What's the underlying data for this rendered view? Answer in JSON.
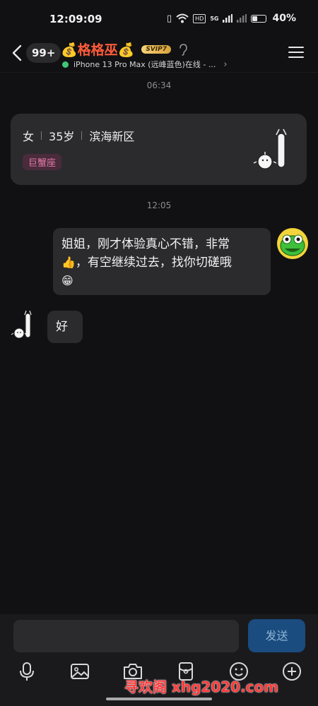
{
  "status_bar": {
    "time": "12:09:09",
    "hd_label": "HD",
    "network": "5G",
    "battery_percent": "40%",
    "battery_level": 0.4
  },
  "header": {
    "unread_count": "99+",
    "contact_name": "💰格格巫💰",
    "vip_label": "SVIP7",
    "device_status": "iPhone 13 Pro Max (远峰蓝色)在线 - ...",
    "online_color": "#3ec878"
  },
  "conversation": {
    "timestamp_1": "06:34",
    "profile": {
      "gender": "女",
      "age": "35岁",
      "location": "滨海新区",
      "zodiac_tag": "巨蟹座"
    },
    "timestamp_2": "12:05",
    "outgoing_message": {
      "line1": "姐姐，刚才体验真心不错，非常",
      "thumb_emoji": "👍",
      "line2": "，有空继续过去，找你切磋哦",
      "grin_emoji": "😁"
    },
    "incoming_message": "好"
  },
  "input": {
    "placeholder": "",
    "send_label": "发送"
  },
  "toolbar_icons": [
    "microphone-icon",
    "image-icon",
    "camera-icon",
    "red-packet-icon",
    "emoji-icon",
    "plus-icon"
  ],
  "watermark": "寻欢阁 xhg2020.com",
  "colors": {
    "background": "#111113",
    "bubble": "#2b2b2e",
    "name_red": "#ff5b3b",
    "send_button": "#1a4c7f",
    "zodiac_pink": "#e07aa6"
  }
}
